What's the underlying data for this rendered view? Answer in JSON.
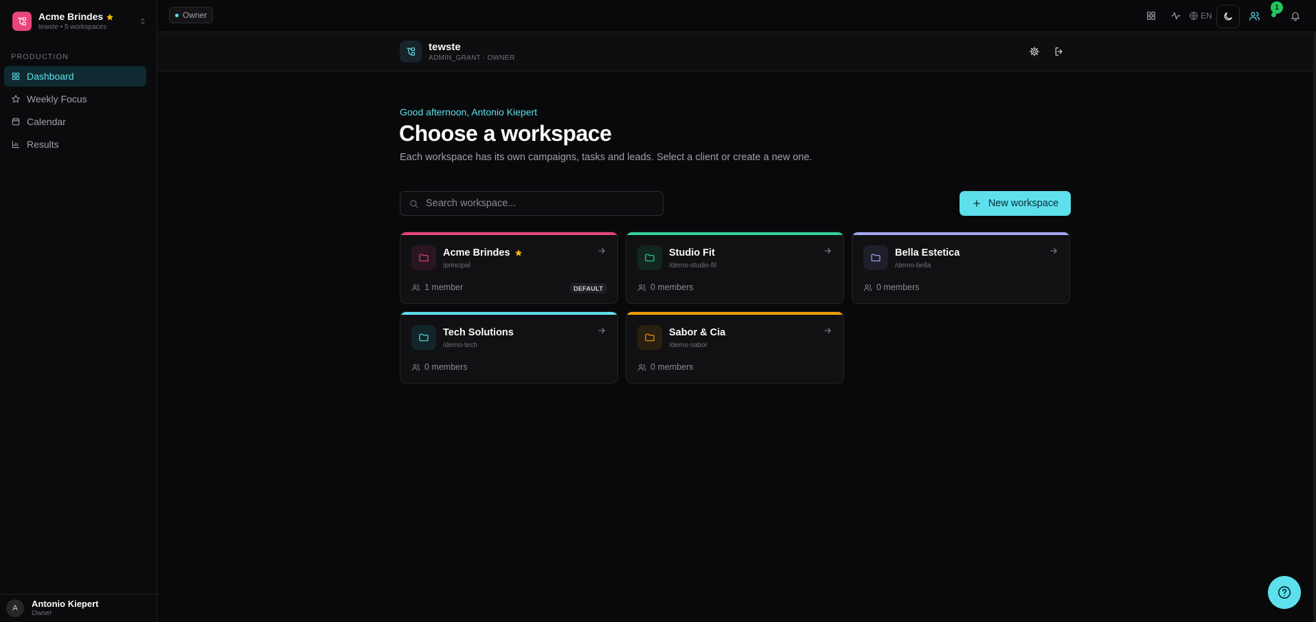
{
  "sidebar": {
    "brand_name": "Acme Brindes",
    "brand_sub": "tewste • 5 workspaces",
    "section_label": "PRODUCTION",
    "items": [
      {
        "label": "Dashboard",
        "icon": "grid-icon",
        "active": true
      },
      {
        "label": "Weekly Focus",
        "icon": "star-icon",
        "active": false
      },
      {
        "label": "Calendar",
        "icon": "calendar-icon",
        "active": false
      },
      {
        "label": "Results",
        "icon": "bar-chart-icon",
        "active": false
      }
    ],
    "user": {
      "initial": "A",
      "name": "Antonio Kiepert",
      "role": "Owner"
    }
  },
  "topbar": {
    "role_badge": "Owner",
    "lang": "EN",
    "notification_count": "1"
  },
  "account": {
    "name": "tewste",
    "sub": "ADMIN_GRANT · OWNER"
  },
  "main": {
    "greeting": "Good afternoon, Antonio Kiepert",
    "title": "Choose a workspace",
    "subtitle": "Each workspace has its own campaigns, tasks and leads. Select a client or create a new one.",
    "search_placeholder": "Search workspace...",
    "new_button": "New workspace",
    "default_label": "DEFAULT"
  },
  "workspaces": [
    {
      "name": "Acme Brindes",
      "slug": "/principal",
      "members": "1 member",
      "color": "#e8457e",
      "icon_bg": "#2a1620",
      "favorite": true,
      "default": true
    },
    {
      "name": "Studio Fit",
      "slug": "/demo-studio-fit",
      "members": "0 members",
      "color": "#34d399",
      "icon_bg": "#12261f",
      "favorite": false,
      "default": false
    },
    {
      "name": "Bella Estetica",
      "slug": "/demo-bella",
      "members": "0 members",
      "color": "#a5a8f5",
      "icon_bg": "#1e1f2a",
      "favorite": false,
      "default": false
    },
    {
      "name": "Tech Solutions",
      "slug": "/demo-tech",
      "members": "0 members",
      "color": "#5ee0ec",
      "icon_bg": "#12262a",
      "favorite": false,
      "default": false
    },
    {
      "name": "Sabor & Cia",
      "slug": "/demo-sabor",
      "members": "0 members",
      "color": "#f59e0b",
      "icon_bg": "#2a1f10",
      "favorite": false,
      "default": false
    }
  ],
  "colors": {
    "accent": "#5ee0ec",
    "brand": "#e8457e",
    "favorite": "#f5b50a",
    "online": "#22c55e"
  }
}
